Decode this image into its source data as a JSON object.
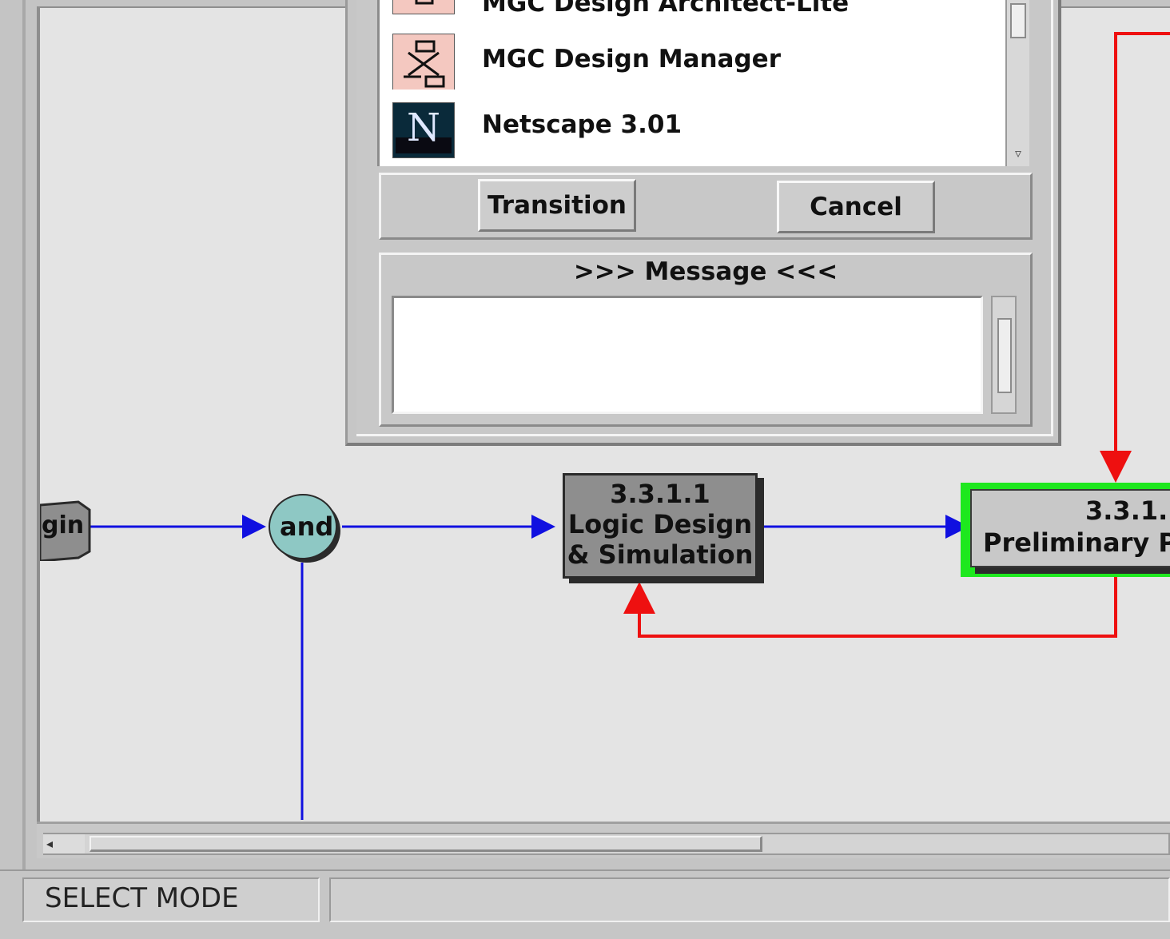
{
  "dialog": {
    "app_items": [
      {
        "label": "MGC Design Architect-Lite",
        "icon": "mgc-design-architect-icon"
      },
      {
        "label": "MGC Design Manager",
        "icon": "mgc-design-manager-icon"
      },
      {
        "label": "Netscape 3.01",
        "icon": "netscape-icon",
        "icon_letter": "N"
      }
    ],
    "transition_label": "Transition",
    "cancel_label": "Cancel",
    "message_title": ">>> Message <<<",
    "message_text": ""
  },
  "diagram": {
    "begin_label": "gin",
    "and_label": "and",
    "node_331": {
      "id": "3.3.1.1",
      "line1": "Logic Design",
      "line2": "& Simulation"
    },
    "node_3312": {
      "id": "3.3.1.",
      "line1": "Preliminary P"
    },
    "colors": {
      "flow_arrow": "#1010e0",
      "rework_arrow": "#ee1010",
      "active_highlight": "#1ee81e",
      "and_fill": "#8ec8c4",
      "task_fill": "#8e8e8e"
    }
  },
  "statusbar": {
    "mode": "SELECT MODE",
    "message": ""
  }
}
